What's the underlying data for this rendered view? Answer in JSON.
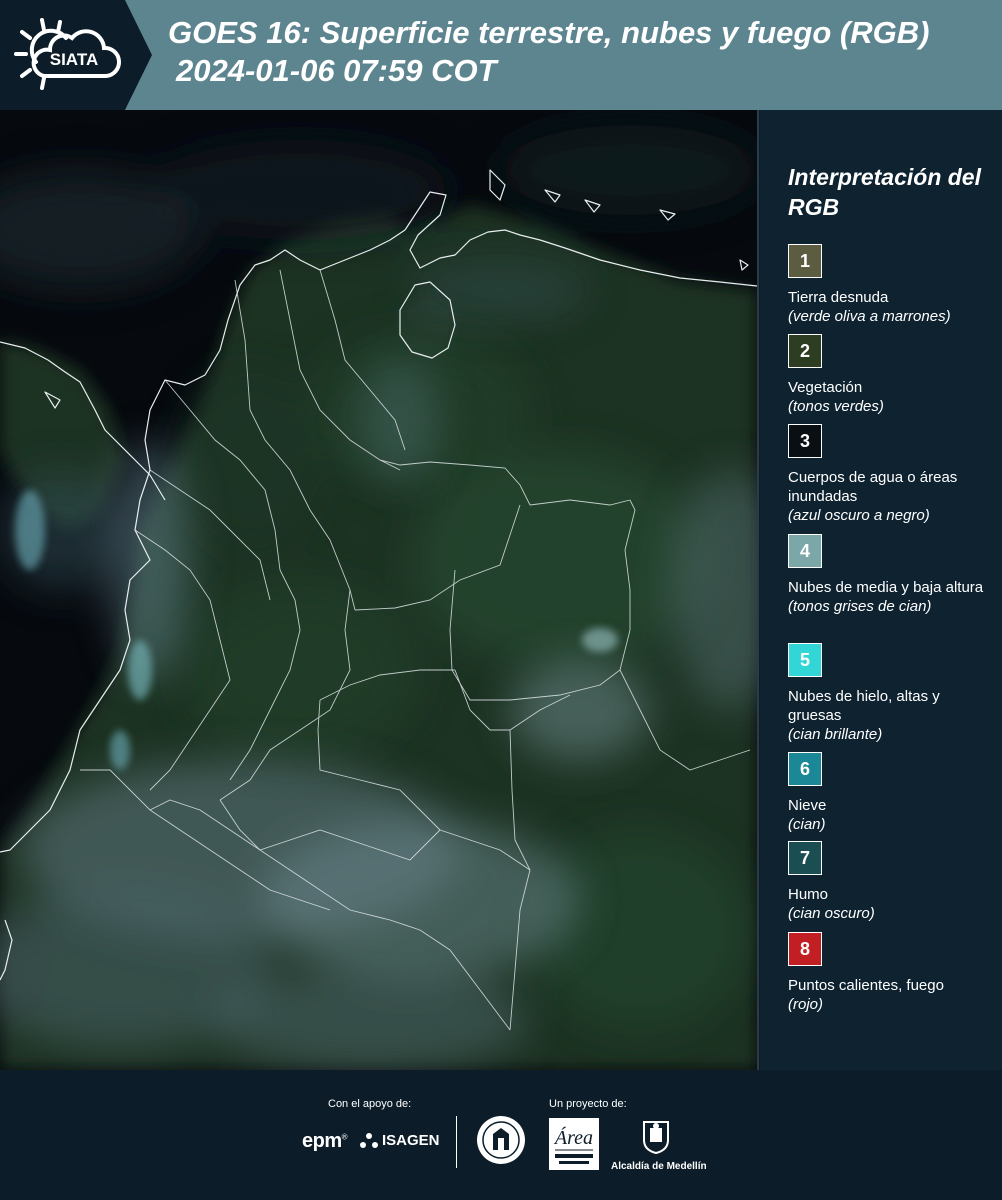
{
  "header": {
    "logo_text": "SIATA",
    "title_line1": "GOES 16: Superficie terrestre, nubes y fuego (RGB)",
    "title_line2": "2024-01-06 07:59 COT"
  },
  "legend": {
    "title": "Interpretación del RGB",
    "items": [
      {
        "number": "1",
        "label": "Tierra desnuda",
        "note": "(verde oliva a marrones)",
        "color": "#5c5c41"
      },
      {
        "number": "2",
        "label": "Vegetación",
        "note": "(tonos verdes)",
        "color": "#2d3d22"
      },
      {
        "number": "3",
        "label": "Cuerpos de agua o áreas inundadas",
        "note": "(azul oscuro a negro)",
        "color": "#0a0f14"
      },
      {
        "number": "4",
        "label": "Nubes de media y baja altura",
        "note": "(tonos grises de cian)",
        "color": "#7ba7a8"
      },
      {
        "number": "5",
        "label": "Nubes de hielo, altas y gruesas",
        "note": "(cian brillante)",
        "color": "#33d6d6"
      },
      {
        "number": "6",
        "label": "Nieve",
        "note": "(cian)",
        "color": "#1c8796"
      },
      {
        "number": "7",
        "label": "Humo",
        "note": "(cian oscuro)",
        "color": "#1b4e52"
      },
      {
        "number": "8",
        "label": "Puntos calientes, fuego",
        "note": "(rojo)",
        "color": "#c11f24"
      }
    ]
  },
  "footer": {
    "support_label": "Con el apoyo de:",
    "project_label": "Un proyecto de:",
    "epm": "epm",
    "isagen": "ISAGEN",
    "alcaldia": "Alcaldía de Medellín"
  }
}
